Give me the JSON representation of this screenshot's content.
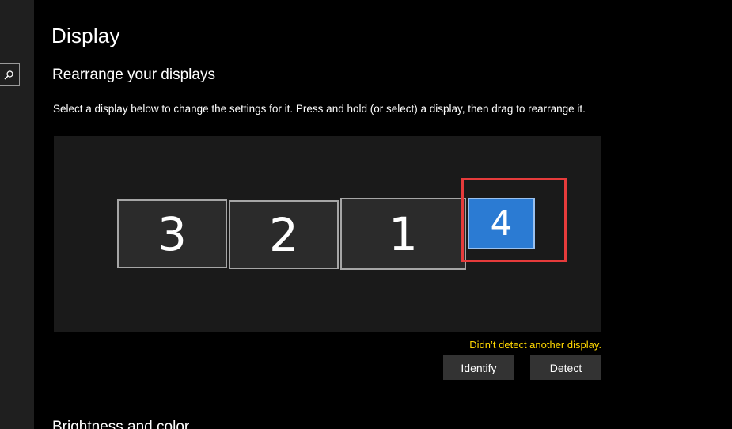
{
  "page": {
    "title": "Display"
  },
  "arrange": {
    "section_title": "Rearrange your displays",
    "instructions": "Select a display below to change the settings for it. Press and hold (or select) a display, then drag to rearrange it.",
    "monitors": [
      {
        "number": "3",
        "selected": false
      },
      {
        "number": "2",
        "selected": false
      },
      {
        "number": "1",
        "selected": false
      },
      {
        "number": "4",
        "selected": true
      }
    ],
    "warning": "Didn’t detect another display.",
    "identify_label": "Identify",
    "detect_label": "Detect"
  },
  "next_section": {
    "title": "Brightness and color"
  },
  "colors": {
    "background": "#000000",
    "selected_monitor": "#2b7bd3",
    "warning": "#ffd700",
    "highlight": "#e63b3b"
  },
  "icons": {
    "search": "search-icon"
  }
}
